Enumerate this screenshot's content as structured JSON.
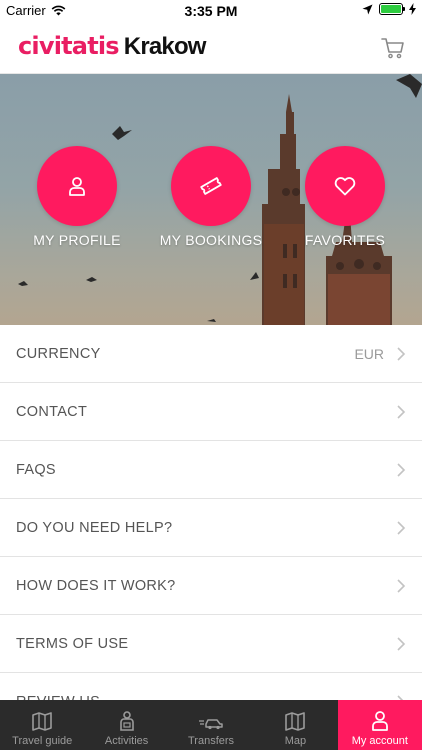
{
  "status_bar": {
    "carrier": "Carrier",
    "time": "3:35 PM"
  },
  "header": {
    "brand": "civitatis",
    "city": "Krakow"
  },
  "hero": {
    "actions": [
      {
        "label": "MY PROFILE",
        "icon": "user-icon"
      },
      {
        "label": "MY BOOKINGS",
        "icon": "ticket-icon"
      },
      {
        "label": "FAVORITES",
        "icon": "heart-icon"
      }
    ]
  },
  "menu": {
    "items": [
      {
        "label": "CURRENCY",
        "value": "EUR"
      },
      {
        "label": "CONTACT",
        "value": ""
      },
      {
        "label": "FAQS",
        "value": ""
      },
      {
        "label": "DO YOU NEED HELP?",
        "value": ""
      },
      {
        "label": "HOW DOES IT WORK?",
        "value": ""
      },
      {
        "label": "TERMS OF USE",
        "value": ""
      },
      {
        "label": "REVIEW US",
        "value": ""
      }
    ]
  },
  "tab_bar": {
    "tabs": [
      {
        "label": "Travel guide",
        "icon": "map-book-icon"
      },
      {
        "label": "Activities",
        "icon": "guide-icon"
      },
      {
        "label": "Transfers",
        "icon": "car-icon"
      },
      {
        "label": "Map",
        "icon": "map-icon"
      },
      {
        "label": "My account",
        "icon": "user-icon"
      }
    ],
    "active_index": 4
  },
  "colors": {
    "accent": "#ff1a5f",
    "tab_bar_bg": "#2b2b2b"
  }
}
